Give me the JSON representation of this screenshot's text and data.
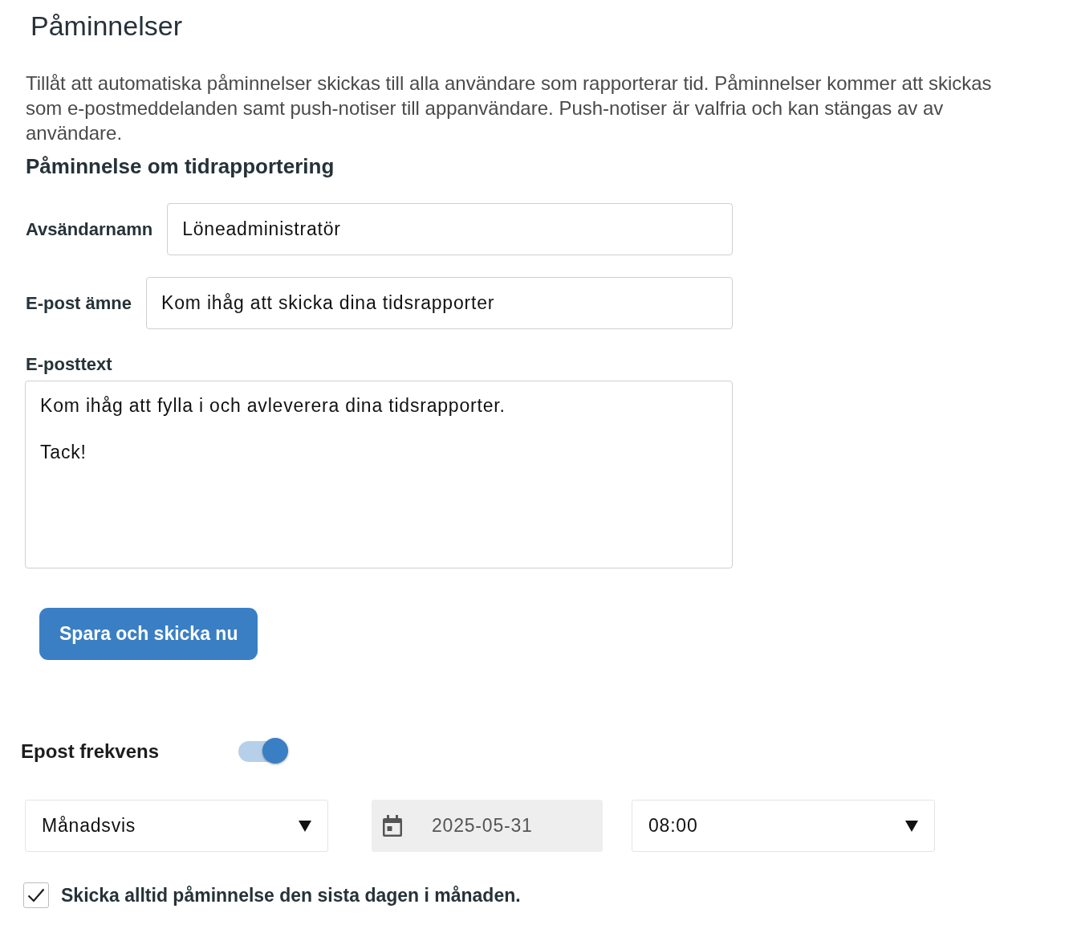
{
  "page": {
    "title": "Påminnelser",
    "description": "Tillåt att automatiska påminnelser skickas till alla användare som rapporterar tid. Påminnelser kommer att skickas som e-postmeddelanden samt push-notiser till appanvändare. Push-notiser är valfria och kan stängas av av användare."
  },
  "reminder": {
    "heading": "Påminnelse om tidrapportering",
    "fields": [
      {
        "kind": "input",
        "label": "Avsändarnamn",
        "value": "Löneadministratör"
      },
      {
        "kind": "input",
        "label": "E-post ämne",
        "value": "Kom ihåg att skicka dina tidsrapporter"
      },
      {
        "kind": "textarea",
        "label": "E-posttext",
        "value": "Kom ihåg att fylla i och avleverera dina tidsrapporter.\n\nTack!"
      }
    ],
    "save_button": "Spara och skicka nu"
  },
  "frequency": {
    "label": "Epost frekvens",
    "on": true,
    "controls": [
      {
        "kind": "select",
        "value": "Månadsvis",
        "disabled": false
      },
      {
        "kind": "date",
        "value": "2025-05-31",
        "disabled": true
      },
      {
        "kind": "select",
        "value": "08:00",
        "disabled": false
      }
    ],
    "last_day": {
      "label": "Skicka alltid påminnelse den sista dagen i månaden.",
      "checked": true
    }
  }
}
